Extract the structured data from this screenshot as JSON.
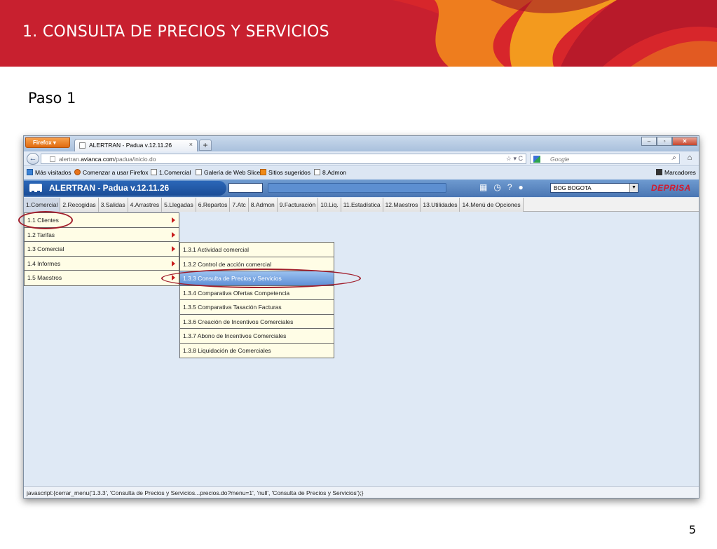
{
  "slide": {
    "title": "1. CONSULTA DE PRECIOS Y SERVICIOS",
    "step": "Paso 1",
    "page_number": "5",
    "accent_color": "#c8202f"
  },
  "browser": {
    "firefox_button": "Firefox",
    "tab_title": "ALERTRAN - Padua  v.12.11.26",
    "url_prefix": "alertran.",
    "url_domain": "avianca.com",
    "url_path": "/padua/inicio.do",
    "search_placeholder": "Google",
    "bookmarks": [
      {
        "label": "Más visitados",
        "icon": "most-visited-icon"
      },
      {
        "label": "Comenzar a usar Firefox",
        "icon": "firefox-icon"
      },
      {
        "label": "1.Comercial",
        "icon": "page-icon"
      },
      {
        "label": "Galería de Web Slice",
        "icon": "web-slice-icon"
      },
      {
        "label": "Sitios sugeridos",
        "icon": "suggested-sites-icon"
      },
      {
        "label": "8.Admon",
        "icon": "page-icon"
      }
    ],
    "bookmarks_menu": "Marcadores",
    "status_text": "javascript:{cerrar_menu('1.3.3', 'Consulta de Precios y Servicios...precios.do?menu=1', 'null', 'Consulta de Precios y Servicios');}"
  },
  "app": {
    "title": "ALERTRAN - Padua  v.12.11.26",
    "office_select": "BOG BOGOTA",
    "logo": "DEPRISA",
    "menu": [
      "1.Comercial",
      "2.Recogidas",
      "3.Salidas",
      "4.Arrastres",
      "5.Llegadas",
      "6.Repartos",
      "7.Atc",
      "8.Admon",
      "9.Facturación",
      "10.Liq.",
      "11.Estadística",
      "12.Maestros",
      "13.Utilidades",
      "14.Menú de Opciones"
    ],
    "submenu": [
      "1.1 Clientes",
      "1.2 Tarifas",
      "1.3 Comercial",
      "1.4 Informes",
      "1.5 Maestros"
    ],
    "submenu_comercial": [
      "1.3.1 Actividad comercial",
      "1.3.2 Control de acción comercial",
      "1.3.3 Consulta de Precios y Servicios",
      "1.3.4 Comparativa Ofertas Competencia",
      "1.3.5 Comparativa Tasación Facturas",
      "1.3.6 Creación de Incentivos Comerciales",
      "1.3.7 Abono de Incentivos Comerciales",
      "1.3.8 Liquidación de Comerciales"
    ],
    "highlighted_item": "1.3.3 Consulta de Precios y Servicios"
  }
}
